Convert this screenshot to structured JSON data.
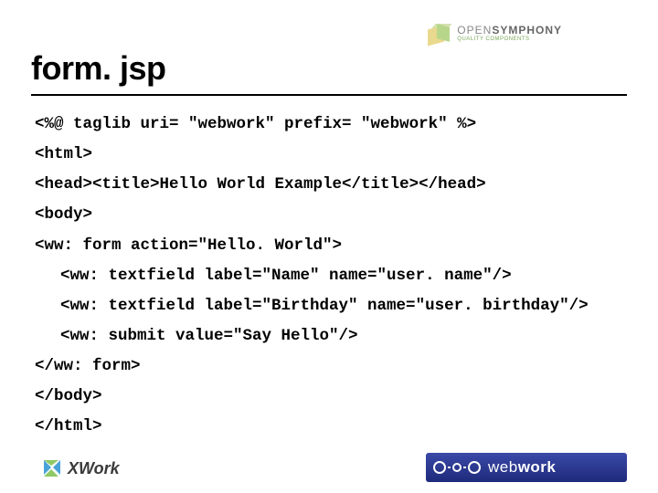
{
  "header": {
    "logo_main_light": "OPEN",
    "logo_main_bold": "SYMPHONY",
    "logo_tagline": "QUALITY COMPONENTS"
  },
  "title": "form. jsp",
  "code": {
    "lines": [
      {
        "text": "<%@ taglib uri= \"webwork\" prefix= \"webwork\" %>",
        "indent": false
      },
      {
        "text": "<html>",
        "indent": false
      },
      {
        "text": "<head><title>Hello World Example</title></head>",
        "indent": false
      },
      {
        "text": "<body>",
        "indent": false
      },
      {
        "text": "<ww: form action=\"Hello. World\">",
        "indent": false
      },
      {
        "text": "<ww: textfield label=\"Name\" name=\"user. name\"/>",
        "indent": true
      },
      {
        "text": "<ww: textfield label=\"Birthday\" name=\"user. birthday\"/>",
        "indent": true
      },
      {
        "text": "<ww: submit value=\"Say Hello\"/>",
        "indent": true
      },
      {
        "text": "</ww: form>",
        "indent": false
      },
      {
        "text": "</body>",
        "indent": false
      },
      {
        "text": "</html>",
        "indent": false
      }
    ]
  },
  "footer": {
    "xwork_label": "XWork",
    "webwork_label_light": "web",
    "webwork_label_bold": "work"
  }
}
